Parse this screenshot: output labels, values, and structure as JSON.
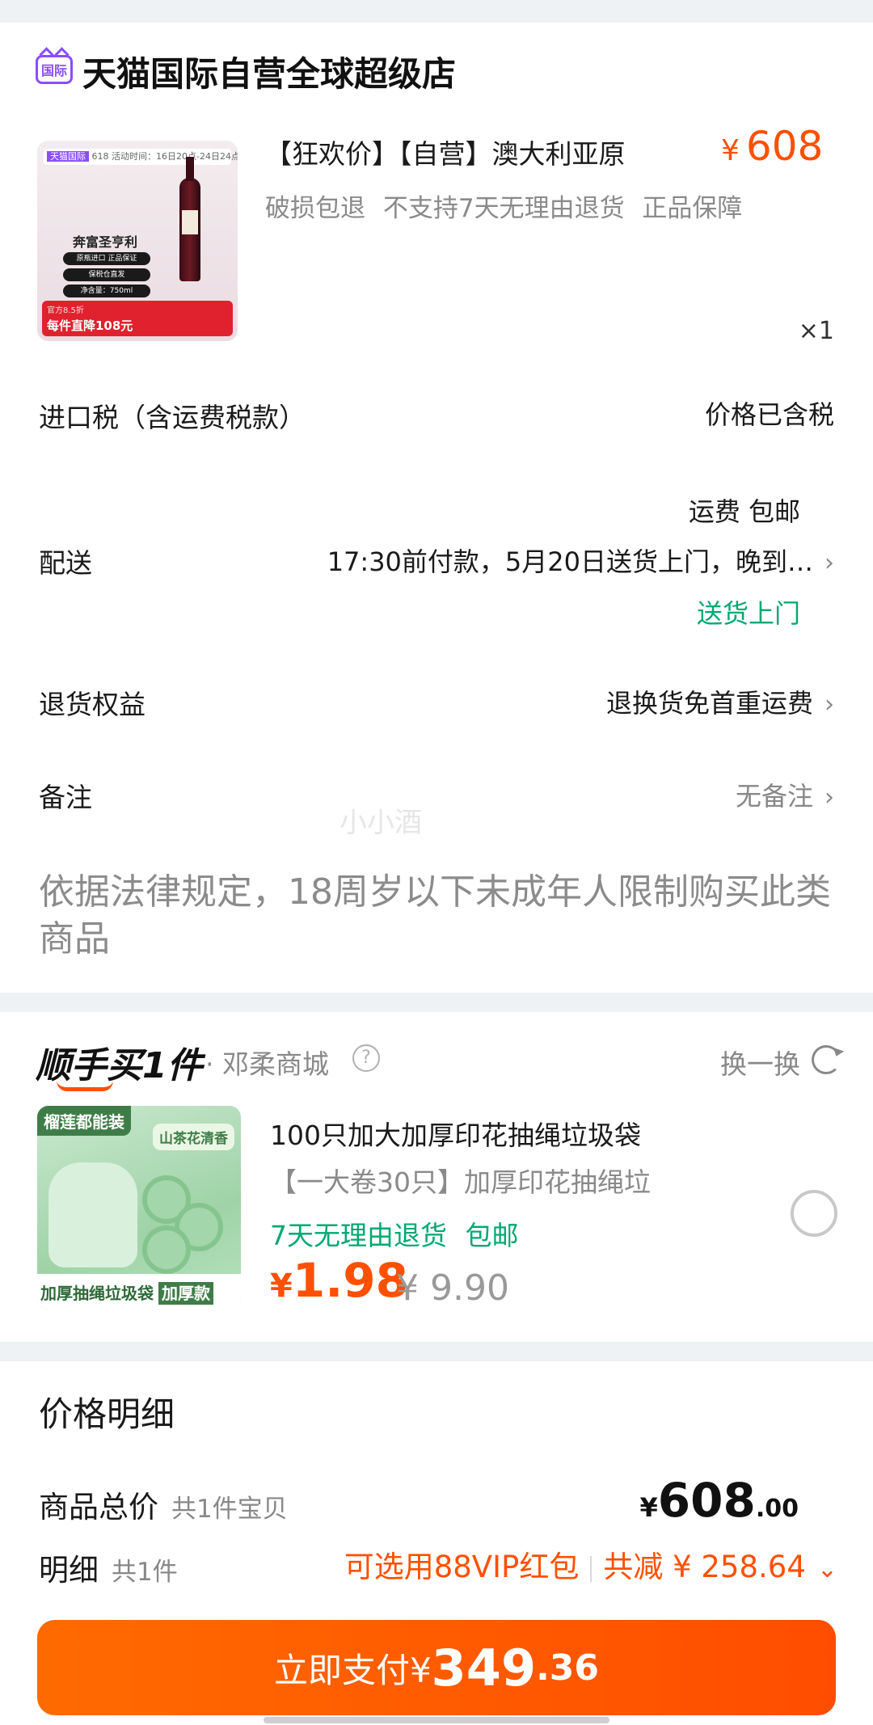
{
  "store": {
    "badge": "国际",
    "name": "天猫国际自营全球超级店"
  },
  "product": {
    "image": {
      "top_strip_badge": "天猫国际",
      "top_strip_text": "618 活动时间：16日20点-24日24点",
      "bottle_title": "奔富圣亨利",
      "pills": [
        "原瓶进口 正品保证",
        "保税仓直发",
        "净含量：750ml"
      ],
      "foot_small": "官方8.5折",
      "foot_text": "每件直降108元"
    },
    "title": "【狂欢价】【自营】澳大利亚原",
    "price_symbol": "¥",
    "price": "608",
    "tags": "破损包退 不支持7天无理由退货 正品保障",
    "quantity": "×1"
  },
  "rows": {
    "tax": {
      "label": "进口税（含运费税款）",
      "value": "价格已含税"
    },
    "delivery": {
      "label": "配送",
      "fee": "运费 包邮",
      "time": "17:30前付款，5月20日送货上门，晚到…",
      "method": "送货上门"
    },
    "returns": {
      "label": "退货权益",
      "value": "退换货免首重运费"
    },
    "remark": {
      "label": "备注",
      "value": "无备注"
    }
  },
  "watermark": "小小酒",
  "notice": "依据法律规定，18周岁以下未成年人限制购买此类商品",
  "addon": {
    "logo": "顺手买1件",
    "shop": "· 邓柔商城",
    "swap_label": "换一换",
    "image": {
      "top": "榴莲都能装",
      "tag": "山茶花清香",
      "foot": "加厚抽绳垃圾袋",
      "foot_badge": "加厚款"
    },
    "title": "100只加大加厚印花抽绳垃圾袋",
    "subtitle": "【一大卷30只】加厚印花抽绳垃",
    "tags": "7天无理由退货 包邮",
    "price_symbol": "¥",
    "price": "1.98",
    "original_price": "¥ 9.90"
  },
  "price_detail": {
    "title": "价格明细",
    "total_label": "商品总价",
    "total_sub": "共1件宝贝",
    "total_symbol": "¥",
    "total_int": "608",
    "total_dec": ".00",
    "detail_label": "明细",
    "detail_sub": "共1件",
    "vip_offer": "可选用88VIP红包",
    "discount": "共减 ¥ 258.64"
  },
  "pay_button": {
    "prefix": "立即支付¥",
    "int": "349",
    "dec": ".36"
  },
  "colors": {
    "accent": "#ff5000",
    "green": "#00a870",
    "purple": "#8b4dff"
  }
}
